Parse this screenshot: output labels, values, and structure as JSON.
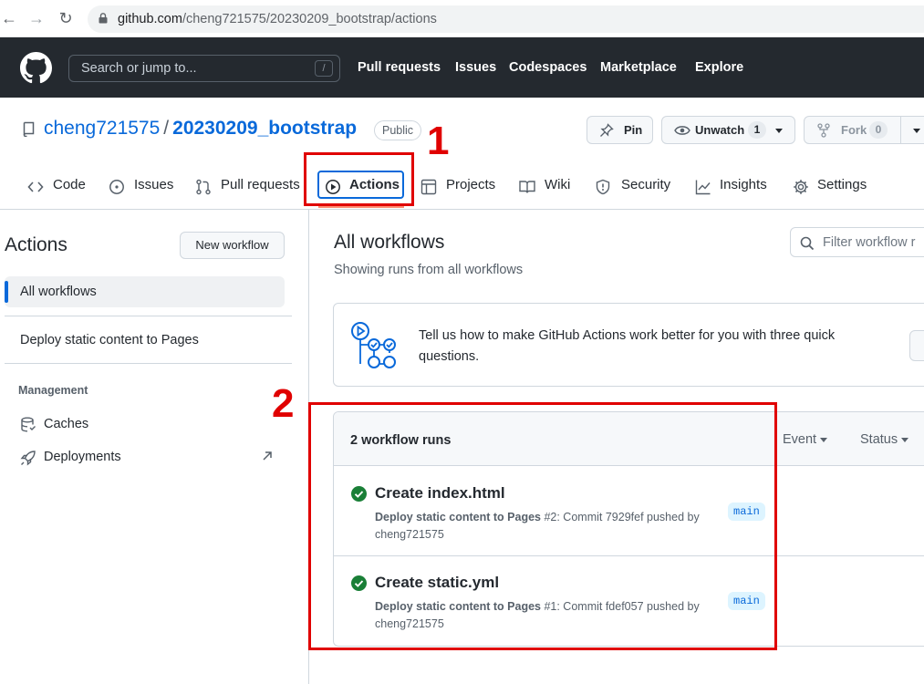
{
  "browser": {
    "url_host": "github.com",
    "url_path": "/cheng721575/20230209_bootstrap/actions"
  },
  "header": {
    "search_placeholder": "Search or jump to...",
    "search_shortcut": "/",
    "nav": [
      "Pull requests",
      "Issues",
      "Codespaces",
      "Marketplace",
      "Explore"
    ]
  },
  "repo": {
    "owner": "cheng721575",
    "separator": "/",
    "name": "20230209_bootstrap",
    "visibility": "Public",
    "pin_label": "Pin",
    "watch_label": "Unwatch",
    "watch_count": "1",
    "fork_label": "Fork",
    "fork_count": "0"
  },
  "tabs": [
    {
      "label": "Code",
      "icon": "code-icon"
    },
    {
      "label": "Issues",
      "icon": "issue-icon"
    },
    {
      "label": "Pull requests",
      "icon": "pull-request-icon"
    },
    {
      "label": "Actions",
      "icon": "play-icon",
      "selected": true
    },
    {
      "label": "Projects",
      "icon": "table-icon"
    },
    {
      "label": "Wiki",
      "icon": "book-icon"
    },
    {
      "label": "Security",
      "icon": "shield-icon"
    },
    {
      "label": "Insights",
      "icon": "graph-icon"
    },
    {
      "label": "Settings",
      "icon": "gear-icon"
    }
  ],
  "annotations": {
    "one": "1",
    "two": "2"
  },
  "sidebar": {
    "title": "Actions",
    "new_workflow": "New workflow",
    "all_workflows": "All workflows",
    "workflows": [
      "Deploy static content to Pages"
    ],
    "management_heading": "Management",
    "management": [
      "Caches",
      "Deployments"
    ]
  },
  "main": {
    "title": "All workflows",
    "subtitle": "Showing runs from all workflows",
    "filter_placeholder": "Filter workflow r",
    "feedback_text": "Tell us how to make GitHub Actions work better for you with three quick questions.",
    "runs_count": "2 workflow runs",
    "filters": [
      "Event",
      "Status"
    ],
    "runs": [
      {
        "title": "Create index.html",
        "workflow": "Deploy static content to Pages",
        "detail": " #2: Commit 7929fef pushed by cheng721575",
        "branch": "main",
        "status": "success"
      },
      {
        "title": "Create static.yml",
        "workflow": "Deploy static content to Pages",
        "detail": " #1: Commit fdef057 pushed by cheng721575",
        "branch": "main",
        "status": "success"
      }
    ]
  },
  "colors": {
    "header_bg": "#24292f",
    "link": "#0969da",
    "annotation_red": "#e00000",
    "success": "#1a7f37",
    "tab_underline": "#fd8c73"
  }
}
